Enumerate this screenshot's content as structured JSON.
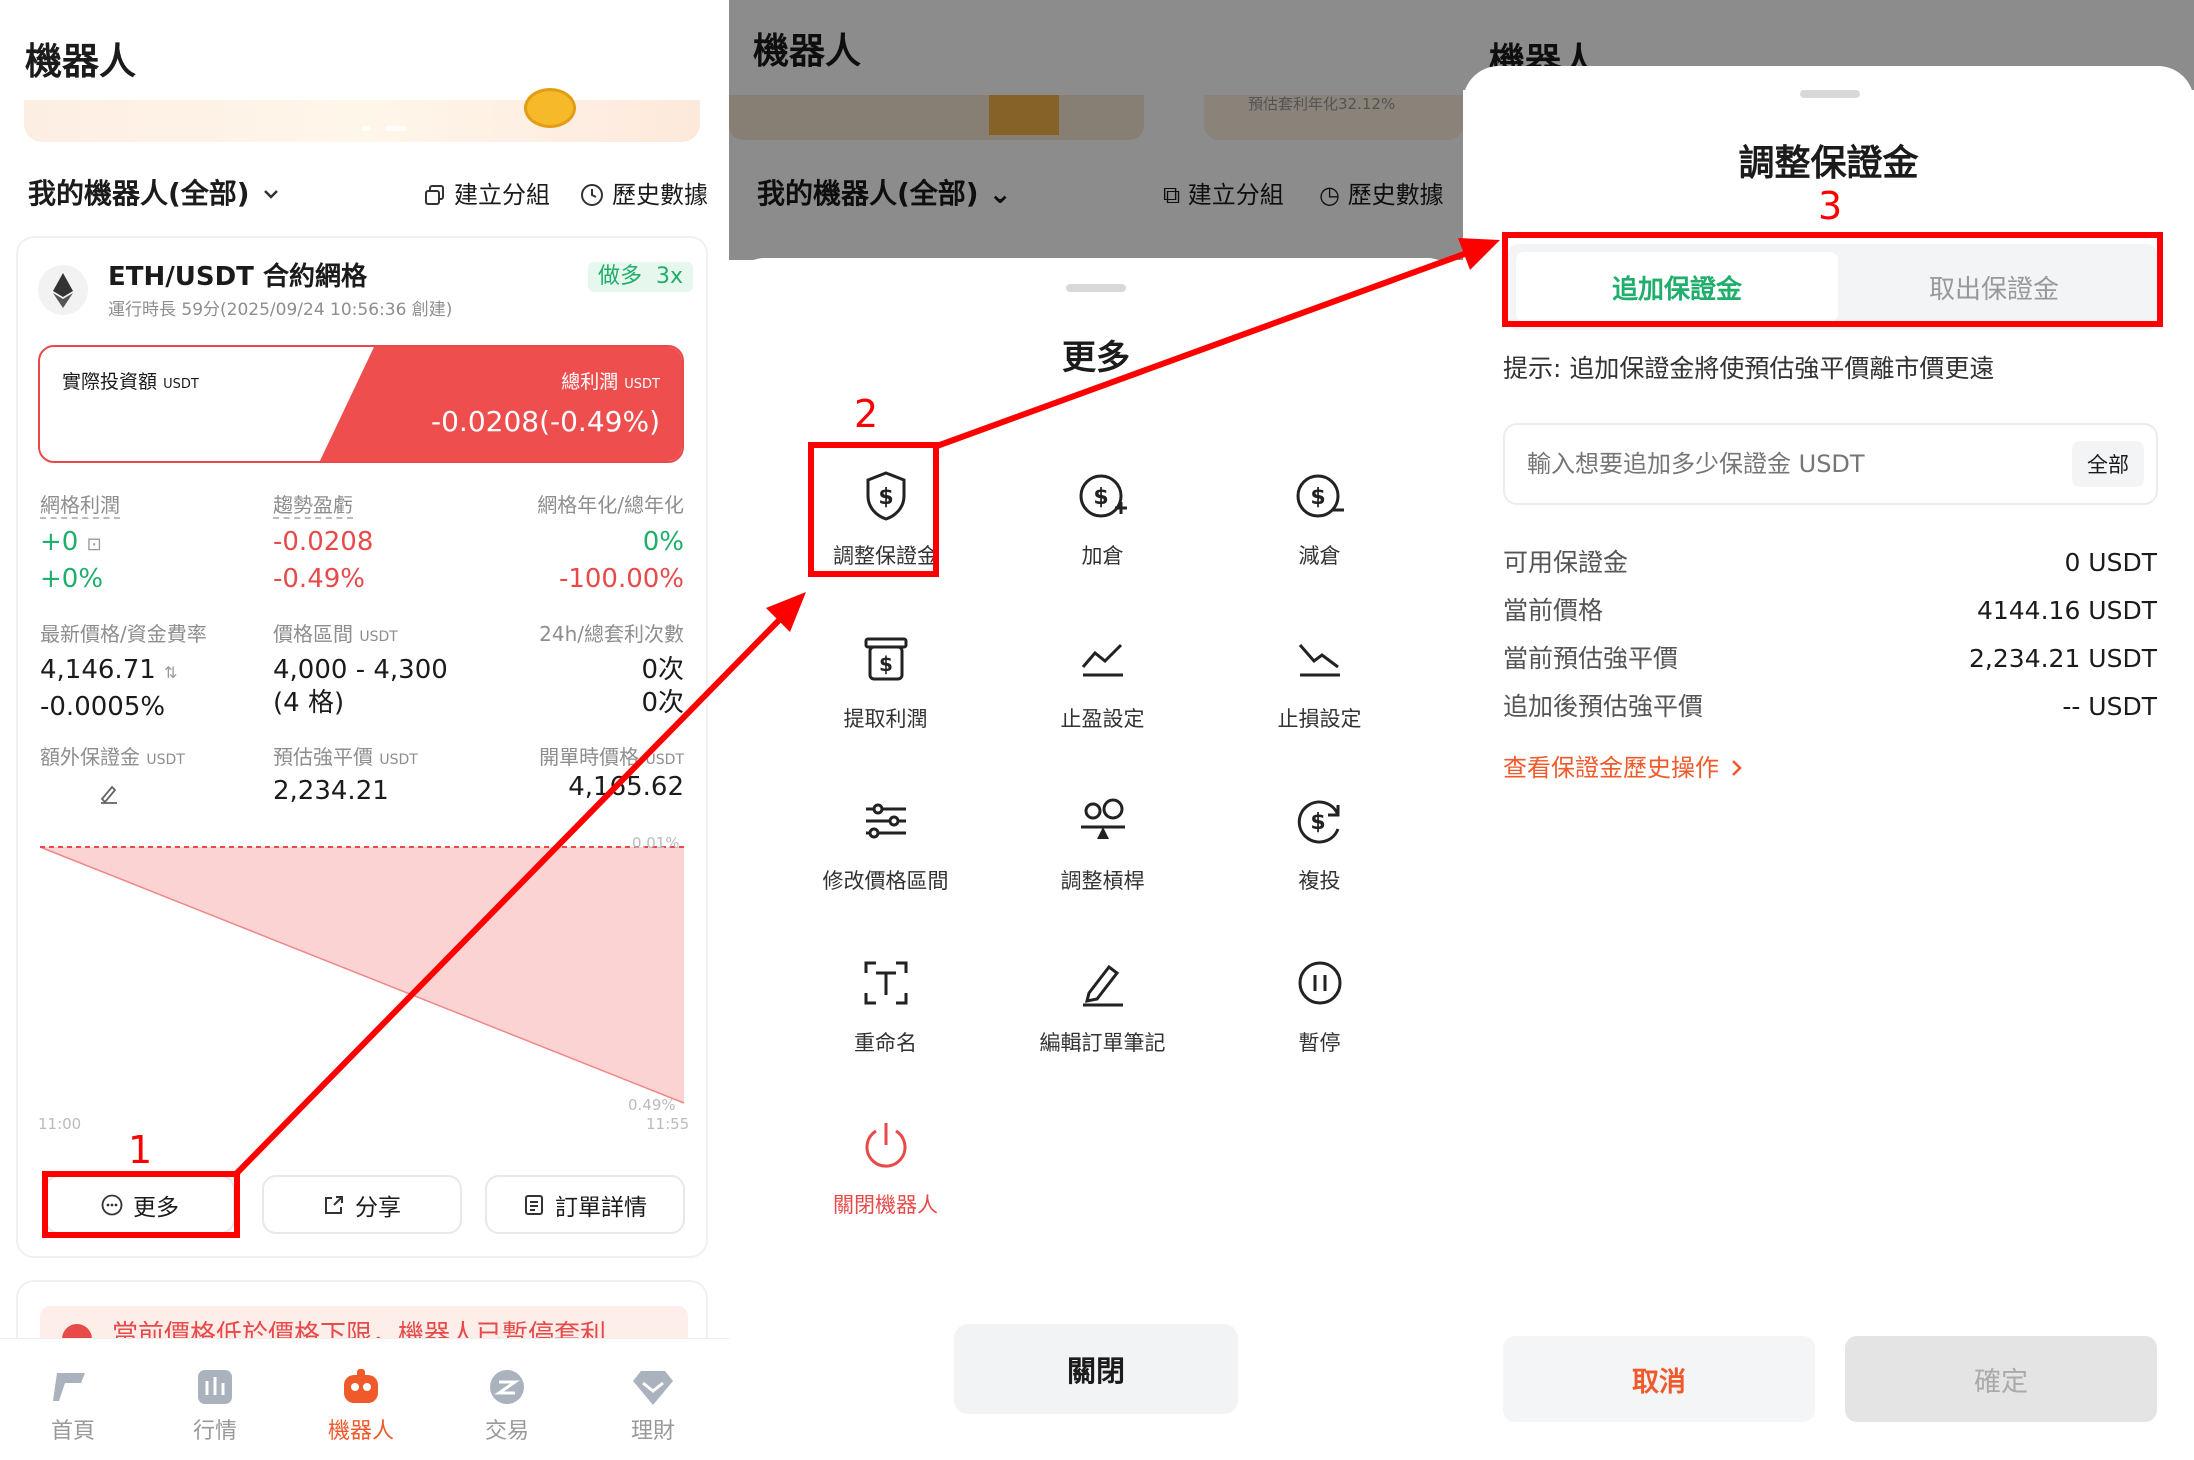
{
  "panel1": {
    "title": "機器人",
    "my_robots_label": "我的機器人(全部)",
    "create_group_label": "建立分組",
    "history_label": "歷史數據",
    "card": {
      "pair": "ETH/USDT 合約網格",
      "direction_badge": "做多",
      "leverage_badge": "3x",
      "runtime": "運行時長 59分(2025/09/24 10:56:36 創建)",
      "investment_label": "實際投資額",
      "investment_unit": "USDT",
      "total_profit_label": "總利潤",
      "total_profit_unit": "USDT",
      "total_profit_value": "-0.0208(-0.49%)",
      "grid_profit_label": "網格利潤",
      "grid_profit_value": "+0",
      "grid_profit_pct": "+0%",
      "trend_pnl_label": "趨勢盈虧",
      "trend_pnl_value": "-0.0208",
      "trend_pnl_pct": "-0.49%",
      "grid_annual_label": "網格年化/總年化",
      "grid_annual_value": "0%",
      "total_annual_value": "-100.00%",
      "last_price_label": "最新價格/資金費率",
      "last_price_value": "4,146.71",
      "funding_rate_value": "-0.0005%",
      "price_range_label": "價格區間",
      "price_range_unit": "USDT",
      "price_range_value": "4,000 - 4,300",
      "grid_count": "(4 格)",
      "arb_count_label": "24h/總套利次數",
      "arb_24h": "0次",
      "arb_total": "0次",
      "extra_margin_label": "額外保證金",
      "extra_margin_unit": "USDT",
      "liq_price_label": "預估強平價",
      "liq_price_unit": "USDT",
      "liq_price_value": "2,234.21",
      "open_price_label": "開單時價格",
      "open_price_unit": "USDT",
      "open_price_value": "4,165.62",
      "chart_top_right": "0.01%",
      "chart_bottom_right": "0.49%",
      "chart_start_time": "11:00",
      "chart_end_time": "11:55"
    },
    "more_button": "更多",
    "share_button": "分享",
    "order_detail_button": "訂單詳情",
    "notice_text": "當前價格低於價格下限，機器人已暫停套利",
    "nav": [
      {
        "label": "首頁",
        "active": false
      },
      {
        "label": "行情",
        "active": false
      },
      {
        "label": "機器人",
        "active": true
      },
      {
        "label": "交易",
        "active": false
      },
      {
        "label": "理財",
        "active": false
      }
    ]
  },
  "panel2": {
    "bg_title": "機器人",
    "bg_my_robots_label": "我的機器人(全部)",
    "bg_create_group_label": "建立分組",
    "bg_history_label": "歷史數據",
    "bg_banner_text": "預估套利年化32.12%",
    "sheet_title": "更多",
    "items": [
      {
        "label": "調整保證金",
        "icon": "shield-dollar-icon"
      },
      {
        "label": "加倉",
        "icon": "dollar-plus-icon"
      },
      {
        "label": "減倉",
        "icon": "dollar-minus-icon"
      },
      {
        "label": "提取利潤",
        "icon": "withdraw-profit-icon"
      },
      {
        "label": "止盈設定",
        "icon": "take-profit-icon"
      },
      {
        "label": "止損設定",
        "icon": "stop-loss-icon"
      },
      {
        "label": "修改價格區間",
        "icon": "sliders-icon"
      },
      {
        "label": "調整槓桿",
        "icon": "leverage-icon"
      },
      {
        "label": "複投",
        "icon": "reinvest-icon"
      },
      {
        "label": "重命名",
        "icon": "rename-icon"
      },
      {
        "label": "編輯訂單筆記",
        "icon": "edit-note-icon"
      },
      {
        "label": "暫停",
        "icon": "pause-icon"
      },
      {
        "label": "關閉機器人",
        "icon": "power-icon"
      }
    ],
    "close_button": "關閉"
  },
  "panel3": {
    "bg_title": "機器人",
    "sheet_title": "調整保證金",
    "tab_add": "追加保證金",
    "tab_remove": "取出保證金",
    "hint": "提示: 追加保證金將使預估強平價離市價更遠",
    "input_placeholder": "輸入想要追加多少保證金 USDT",
    "all_button": "全部",
    "rows": [
      {
        "label": "可用保證金",
        "value": "0 USDT"
      },
      {
        "label": "當前價格",
        "value": "4144.16 USDT"
      },
      {
        "label": "當前預估強平價",
        "value": "2,234.21 USDT"
      },
      {
        "label": "追加後預估強平價",
        "value": "-- USDT"
      }
    ],
    "history_link": "查看保證金歷史操作",
    "cancel_button": "取消",
    "confirm_button": "確定"
  },
  "annotations": {
    "step1": "1",
    "step2": "2",
    "step3": "3"
  },
  "colors": {
    "accent_orange": "#f0592a",
    "profit_green": "#1fae6b",
    "loss_red": "#e84a4a",
    "highlight_red": "#ff0000"
  }
}
